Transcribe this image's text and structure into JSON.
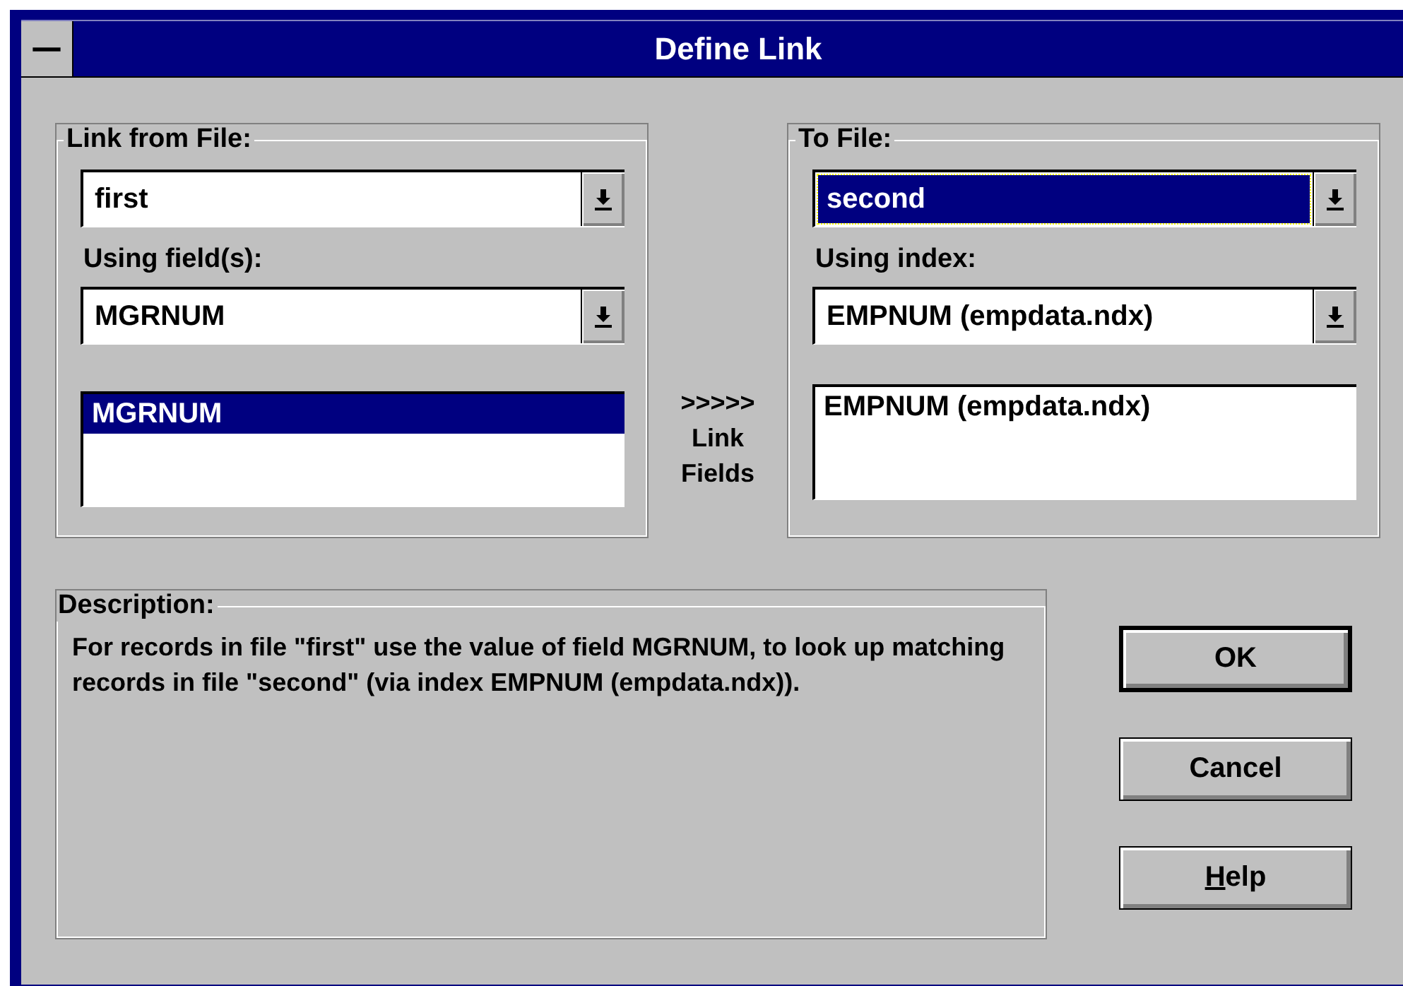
{
  "window": {
    "title": "Define Link",
    "system_menu": "—"
  },
  "link_from": {
    "title": "Link from File:",
    "file_dropdown": {
      "value": "first",
      "focused": false
    },
    "fields_label": "Using field(s):",
    "fields_dropdown": {
      "value": "MGRNUM",
      "focused": false
    },
    "list": [
      {
        "text": "MGRNUM",
        "selected": true
      }
    ]
  },
  "link_action": {
    "arrows": ">>>>>",
    "label": "Link\nFields"
  },
  "to_file": {
    "title": "To File:",
    "file_dropdown": {
      "value": "second",
      "focused": true
    },
    "index_label": "Using index:",
    "index_dropdown": {
      "value": "EMPNUM (empdata.ndx)",
      "focused": false
    },
    "list": [
      {
        "text": "EMPNUM (empdata.ndx)",
        "selected": false
      }
    ]
  },
  "description": {
    "title": "Description:",
    "text": "For records in file \"first\" use the value of field MGRNUM, to look up matching records in file \"second\" (via index EMPNUM (empdata.ndx))."
  },
  "buttons": [
    {
      "label": "OK",
      "default": true,
      "mnemonic_first": false
    },
    {
      "label": "Cancel",
      "default": false,
      "mnemonic_first": false
    },
    {
      "label": "Help",
      "default": false,
      "mnemonic_first": true
    }
  ]
}
